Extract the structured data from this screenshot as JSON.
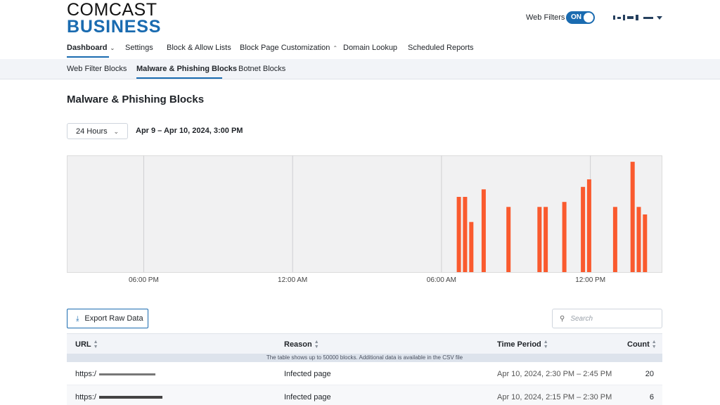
{
  "header": {
    "logo_top": "COMCAST",
    "logo_bottom": "BUSINESS",
    "web_filters_label": "Web Filters",
    "toggle_label": "ON"
  },
  "nav_primary": [
    {
      "label": "Dashboard",
      "active": true,
      "chevron": "down"
    },
    {
      "label": "Settings"
    },
    {
      "label": "Block & Allow Lists"
    },
    {
      "label": "Block Page Customization",
      "chevron": "up"
    },
    {
      "label": "Domain Lookup"
    },
    {
      "label": "Scheduled Reports"
    }
  ],
  "nav_secondary": [
    {
      "label": "Web Filter Blocks"
    },
    {
      "label": "Malware & Phishing Blocks",
      "active": true
    },
    {
      "label": "Botnet Blocks"
    }
  ],
  "page_title": "Malware & Phishing Blocks",
  "range": {
    "selected": "24 Hours",
    "label": "Apr 9 – Apr 10, 2024, 3:00 PM"
  },
  "chart_data": {
    "type": "bar",
    "x_tick_labels": [
      "06:00 PM",
      "12:00 AM",
      "06:00 AM",
      "12:00 PM"
    ],
    "x_tick_hours": [
      6,
      12,
      18,
      24
    ],
    "x_range_hours": [
      2.9,
      26.9
    ],
    "bar_color": "#fa5a2e",
    "grid": true,
    "ylim": [
      0,
      23
    ],
    "bars": [
      {
        "hour": 18.7,
        "value": 15
      },
      {
        "hour": 18.95,
        "value": 15
      },
      {
        "hour": 19.2,
        "value": 10
      },
      {
        "hour": 19.7,
        "value": 16.5
      },
      {
        "hour": 20.7,
        "value": 13
      },
      {
        "hour": 21.95,
        "value": 13
      },
      {
        "hour": 22.2,
        "value": 13
      },
      {
        "hour": 22.95,
        "value": 14
      },
      {
        "hour": 23.7,
        "value": 17
      },
      {
        "hour": 23.95,
        "value": 18.5
      },
      {
        "hour": 25.0,
        "value": 13
      },
      {
        "hour": 25.7,
        "value": 22
      },
      {
        "hour": 25.95,
        "value": 13
      },
      {
        "hour": 26.2,
        "value": 11.5
      }
    ]
  },
  "table": {
    "export_label": "Export Raw Data",
    "search_placeholder": "Search",
    "columns": [
      "URL",
      "Reason",
      "Time Period",
      "Count"
    ],
    "notice": "The table shows up to 50000 blocks. Additional data is available in the CSV file",
    "rows": [
      {
        "url": "https:/",
        "reason": "Infected page",
        "period": "Apr 10, 2024, 2:30 PM – 2:45 PM",
        "count": "20"
      },
      {
        "url": "https:/",
        "reason": "Infected page",
        "period": "Apr 10, 2024, 2:15 PM – 2:30 PM",
        "count": "6"
      }
    ]
  }
}
